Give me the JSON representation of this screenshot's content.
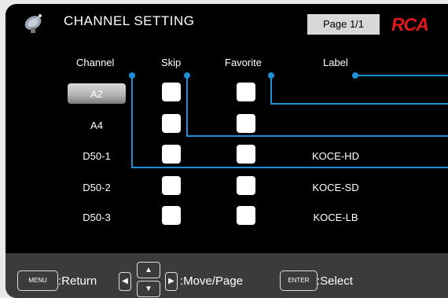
{
  "header": {
    "title": "CHANNEL SETTING",
    "page": "Page 1/1",
    "brand": "RCA"
  },
  "columns": {
    "channel": "Channel",
    "skip": "Skip",
    "favorite": "Favorite",
    "label": "Label"
  },
  "rows": [
    {
      "channel": "A2",
      "label": ""
    },
    {
      "channel": "A4",
      "label": ""
    },
    {
      "channel": "D50-1",
      "label": "KOCE-HD"
    },
    {
      "channel": "D50-2",
      "label": "KOCE-SD"
    },
    {
      "channel": "D50-3",
      "label": "KOCE-LB"
    }
  ],
  "footer": {
    "menu_key": "MENU",
    "return_text": ":Return",
    "move_text": ":Move/Page",
    "enter_key": "ENTER",
    "select_text": ":Select"
  },
  "colors": {
    "background": "#000000",
    "accent_line": "#1d8fd6",
    "brand": "#e01818",
    "footer": "#3b3b3b"
  },
  "icons": [
    "satellite-dish-icon",
    "arrow-left-icon",
    "arrow-up-icon",
    "arrow-down-icon",
    "arrow-right-icon"
  ]
}
